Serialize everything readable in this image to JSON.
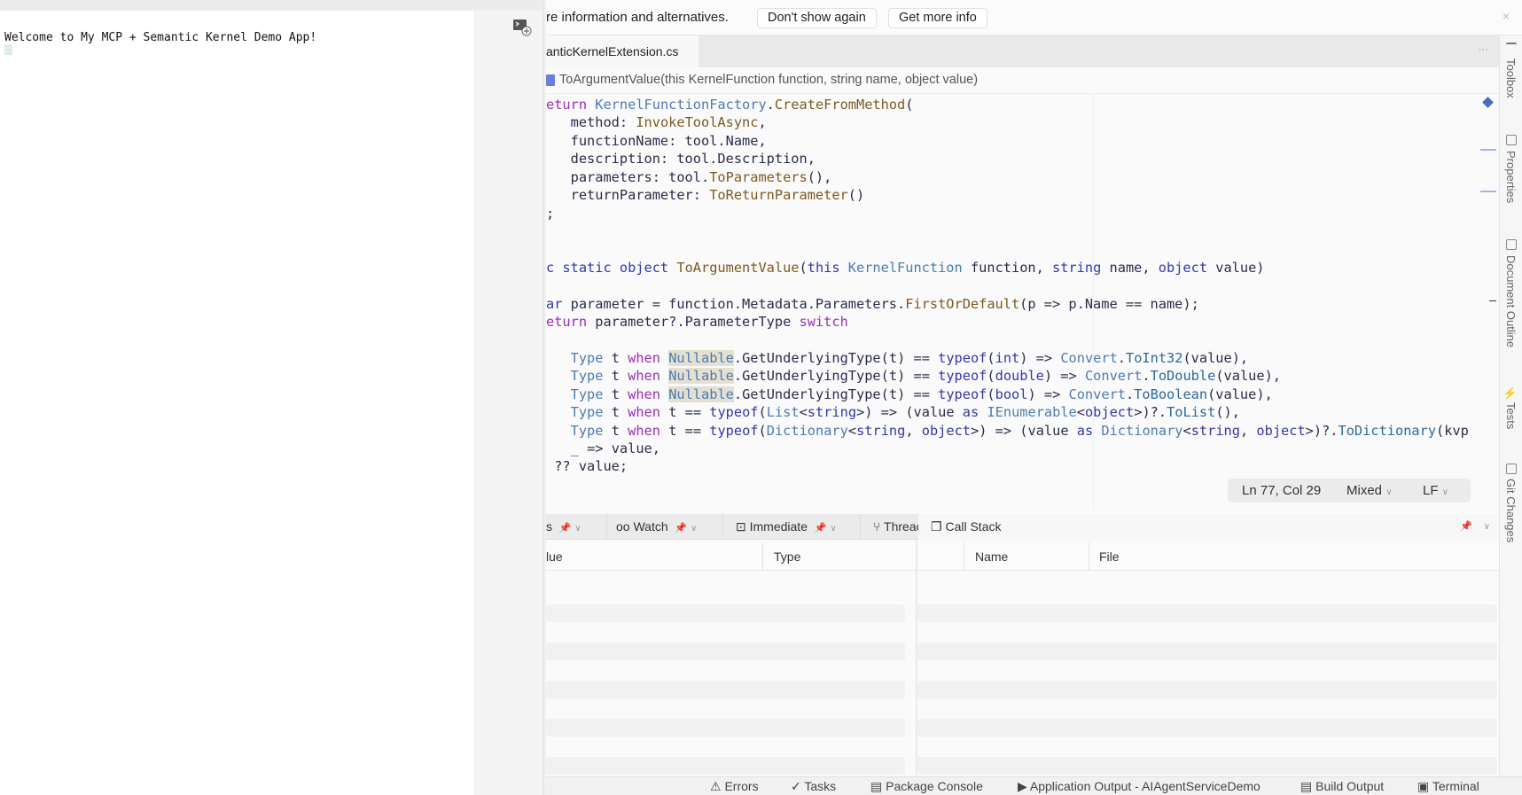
{
  "terminal": {
    "welcome": "Welcome to My MCP + Semantic Kernel Demo App!"
  },
  "infobar": {
    "text": "re information and alternatives.",
    "dont_show": "Don't show again",
    "more_info": "Get more info",
    "close": "×"
  },
  "editor": {
    "tab": "anticKernelExtension.cs",
    "tab_more": "···",
    "breadcrumb": "ToArgumentValue(this KernelFunction function, string name, object value)",
    "lines": [
      [
        [
          "eturn ",
          "kw2"
        ],
        [
          "KernelFunctionFactory",
          "ty"
        ],
        [
          ".",
          ""
        ],
        [
          "CreateFromMethod",
          "me"
        ],
        [
          "(",
          ""
        ]
      ],
      [
        [
          "   method: ",
          ""
        ],
        [
          "InvokeToolAsync",
          "me"
        ],
        [
          ",",
          ""
        ]
      ],
      [
        [
          "   functionName: tool.Name,",
          ""
        ]
      ],
      [
        [
          "   description: tool.Description,",
          ""
        ]
      ],
      [
        [
          "   parameters: tool.",
          ""
        ],
        [
          "ToParameters",
          "me"
        ],
        [
          "(),",
          ""
        ]
      ],
      [
        [
          "   returnParameter: ",
          ""
        ],
        [
          "ToReturnParameter",
          "me"
        ],
        [
          "()",
          ""
        ]
      ],
      [
        [
          ";",
          ""
        ]
      ],
      [],
      [],
      [
        [
          "c static object ",
          "kw"
        ],
        [
          "ToArgumentValue",
          "me"
        ],
        [
          "(",
          ""
        ],
        [
          "this ",
          "kw"
        ],
        [
          "KernelFunction",
          "ty"
        ],
        [
          " function, ",
          ""
        ],
        [
          "string",
          "kw"
        ],
        [
          " name, ",
          ""
        ],
        [
          "object",
          "kw"
        ],
        [
          " value)",
          ""
        ]
      ],
      [],
      [
        [
          "ar ",
          "kw"
        ],
        [
          "parameter = function.Metadata.Parameters.",
          ""
        ],
        [
          "FirstOrDefault",
          "me"
        ],
        [
          "(p => p.Name == name);",
          ""
        ]
      ],
      [
        [
          "eturn ",
          "kw2"
        ],
        [
          "parameter?.ParameterType ",
          ""
        ],
        [
          "switch",
          "kw2"
        ]
      ],
      [],
      [
        [
          "   ",
          ""
        ],
        [
          "Type",
          "ty"
        ],
        [
          " t ",
          ""
        ],
        [
          "when ",
          "kw2"
        ],
        [
          "Nullable",
          "ty hl"
        ],
        [
          ".GetUnderlyingType(t) == ",
          ""
        ],
        [
          "typeof",
          "kw"
        ],
        [
          "(",
          ""
        ],
        [
          "int",
          "kw"
        ],
        [
          ") => ",
          ""
        ],
        [
          "Convert",
          "ty"
        ],
        [
          ".",
          ""
        ],
        [
          "ToInt32",
          "mi"
        ],
        [
          "(value),",
          ""
        ]
      ],
      [
        [
          "   ",
          ""
        ],
        [
          "Type",
          "ty"
        ],
        [
          " t ",
          ""
        ],
        [
          "when ",
          "kw2"
        ],
        [
          "Nullable",
          "ty hl"
        ],
        [
          ".GetUnderlyingType(t) == ",
          ""
        ],
        [
          "typeof",
          "kw"
        ],
        [
          "(",
          ""
        ],
        [
          "double",
          "kw"
        ],
        [
          ") => ",
          ""
        ],
        [
          "Convert",
          "ty"
        ],
        [
          ".",
          ""
        ],
        [
          "ToDouble",
          "mi"
        ],
        [
          "(value),",
          ""
        ]
      ],
      [
        [
          "   ",
          ""
        ],
        [
          "Type",
          "ty"
        ],
        [
          " t ",
          ""
        ],
        [
          "when ",
          "kw2"
        ],
        [
          "Nullable",
          "ty hl"
        ],
        [
          ".GetUnderlyingType(t) == ",
          ""
        ],
        [
          "typeof",
          "kw"
        ],
        [
          "(",
          ""
        ],
        [
          "bool",
          "kw"
        ],
        [
          ") => ",
          ""
        ],
        [
          "Convert",
          "ty"
        ],
        [
          ".",
          ""
        ],
        [
          "ToBoolean",
          "mi"
        ],
        [
          "(value),",
          ""
        ]
      ],
      [
        [
          "   ",
          ""
        ],
        [
          "Type",
          "ty"
        ],
        [
          " t ",
          ""
        ],
        [
          "when ",
          "kw2"
        ],
        [
          "t == ",
          ""
        ],
        [
          "typeof",
          "kw"
        ],
        [
          "(",
          ""
        ],
        [
          "List",
          "ty"
        ],
        [
          "<",
          ""
        ],
        [
          "string",
          "kw"
        ],
        [
          ">) => (value ",
          ""
        ],
        [
          "as ",
          "kw"
        ],
        [
          "IEnumerable",
          "ty"
        ],
        [
          "<",
          ""
        ],
        [
          "object",
          "kw"
        ],
        [
          ">)?.",
          ""
        ],
        [
          "ToList",
          "mi"
        ],
        [
          "(),",
          ""
        ]
      ],
      [
        [
          "   ",
          ""
        ],
        [
          "Type",
          "ty"
        ],
        [
          " t ",
          ""
        ],
        [
          "when ",
          "kw2"
        ],
        [
          "t == ",
          ""
        ],
        [
          "typeof",
          "kw"
        ],
        [
          "(",
          ""
        ],
        [
          "Dictionary",
          "ty"
        ],
        [
          "<",
          ""
        ],
        [
          "string",
          "kw"
        ],
        [
          ", ",
          ""
        ],
        [
          "object",
          "kw"
        ],
        [
          ">) => (value ",
          ""
        ],
        [
          "as ",
          "kw"
        ],
        [
          "Dictionary",
          "ty"
        ],
        [
          "<",
          ""
        ],
        [
          "string",
          "kw"
        ],
        [
          ", ",
          ""
        ],
        [
          "object",
          "kw"
        ],
        [
          ">)?.",
          ""
        ],
        [
          "ToDictionary",
          "mi"
        ],
        [
          "(kvp",
          ""
        ]
      ],
      [
        [
          "   ",
          ""
        ],
        [
          "_",
          "kw"
        ],
        [
          " => value,",
          ""
        ]
      ],
      [
        [
          " ?? value;",
          ""
        ]
      ]
    ],
    "status": {
      "position": "Ln 77, Col 29",
      "encoding": "Mixed",
      "line_ending": "LF"
    }
  },
  "right_sidebar": [
    "Toolbox",
    "Properties",
    "Document Outline",
    "Tests",
    "Git Changes"
  ],
  "debug_pads": {
    "tabs": {
      "locals_suffix": "s",
      "watch": "Watch",
      "immediate": "Immediate",
      "threads": "Threac",
      "call_stack": "Call Stack"
    },
    "left_headers": [
      "lue",
      "Type"
    ],
    "right_headers": [
      "Name",
      "File"
    ]
  },
  "bottom_bar": [
    "Errors",
    "Tasks",
    "Package Console",
    "Application Output - AIAgentServiceDemo",
    "Build Output",
    "Terminal"
  ]
}
